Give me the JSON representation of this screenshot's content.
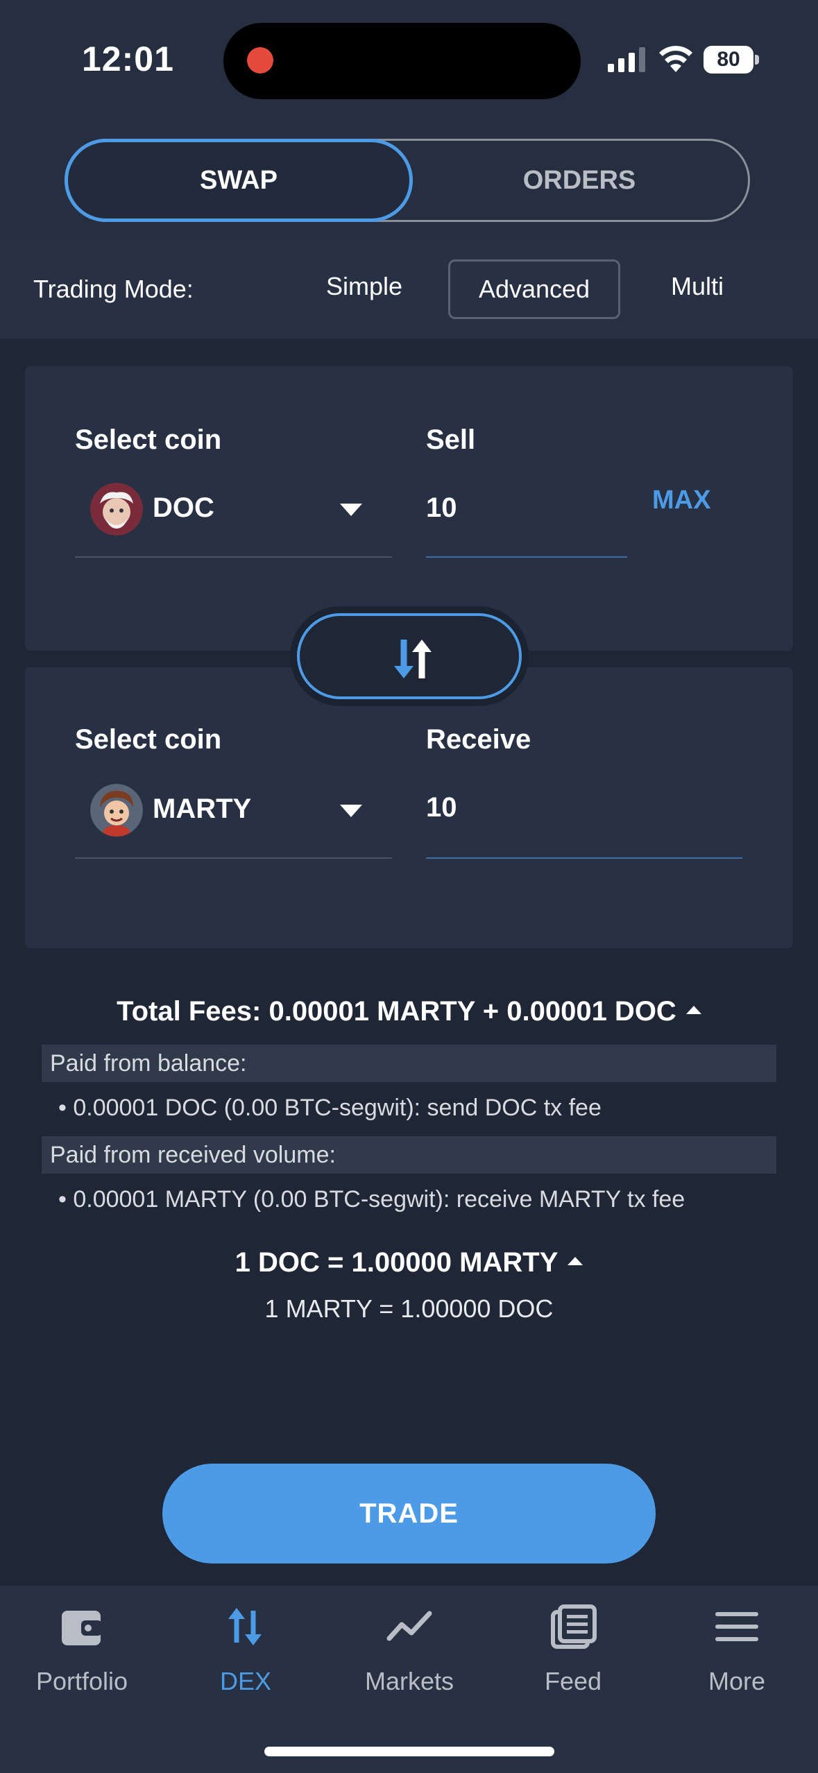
{
  "status_bar": {
    "time": "12:01",
    "battery": "80"
  },
  "tabs": {
    "swap": "SWAP",
    "orders": "ORDERS"
  },
  "trading_mode": {
    "label": "Trading Mode:",
    "options": [
      "Simple",
      "Advanced",
      "Multi"
    ],
    "selected": "Advanced"
  },
  "sell_card": {
    "select_label": "Select coin",
    "coin": "DOC",
    "amount_label": "Sell",
    "amount": "10",
    "max_label": "MAX"
  },
  "receive_card": {
    "select_label": "Select coin",
    "coin": "MARTY",
    "amount_label": "Receive",
    "amount": "10"
  },
  "fees": {
    "title": "Total Fees: 0.00001 MARTY + 0.00001 DOC",
    "paid_from_balance_label": "Paid from balance:",
    "balance_fee": "• 0.00001 DOC (0.00 BTC-segwit): send DOC tx fee",
    "paid_from_received_label": "Paid from received volume:",
    "received_fee": "• 0.00001 MARTY (0.00 BTC-segwit): receive MARTY tx fee"
  },
  "rates": {
    "primary": "1 DOC = 1.00000 MARTY",
    "secondary": "1 MARTY = 1.00000 DOC"
  },
  "trade_button": "TRADE",
  "nav": {
    "items": [
      {
        "label": "Portfolio",
        "icon": "wallet-icon"
      },
      {
        "label": "DEX",
        "icon": "swap-arrows-icon",
        "active": true
      },
      {
        "label": "Markets",
        "icon": "trend-line-icon"
      },
      {
        "label": "Feed",
        "icon": "news-feed-icon"
      },
      {
        "label": "More",
        "icon": "menu-icon"
      }
    ]
  },
  "colors": {
    "accent": "#4d9be6",
    "background": "#1f2736",
    "card": "#283143"
  }
}
